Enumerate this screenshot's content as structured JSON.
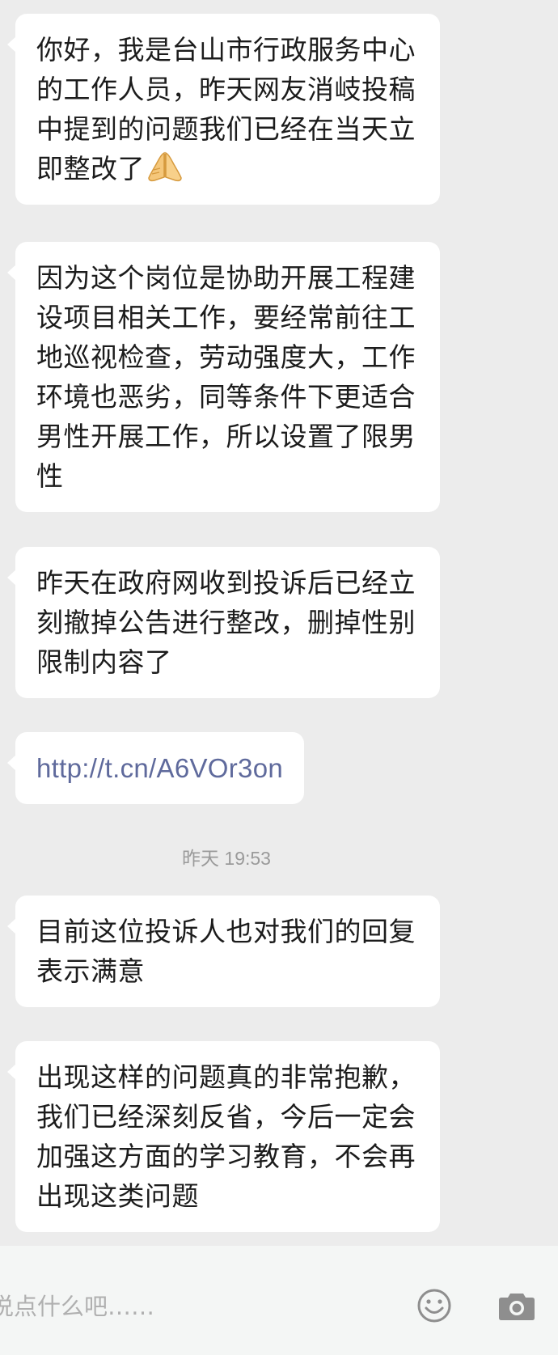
{
  "messages": [
    {
      "text": "你好，我是台山市行政服务中心的工作人员，昨天网友消岐投稿中提到的问题我们已经在当天立即整改了",
      "emoji": "folded-hands-emoji"
    },
    {
      "text": "因为这个岗位是协助开展工程建设项目相关工作，要经常前往工地巡视检查，劳动强度大，工作环境也恶劣，同等条件下更适合男性开展工作，所以设置了限男性"
    },
    {
      "text": "昨天在政府网收到投诉后已经立刻撤掉公告进行整改，删掉性别限制内容了"
    },
    {
      "text": "http://t.cn/A6VOr3on"
    },
    {
      "text": "目前这位投诉人也对我们的回复表示满意"
    },
    {
      "text": "出现这样的问题真的非常抱歉，我们已经深刻反省，今后一定会加强这方面的学习教育，不会再出现这类问题"
    }
  ],
  "timestamp": "昨天 19:53",
  "input": {
    "placeholder": "说点什么吧……",
    "value": ""
  },
  "icons": {
    "emoji_button": "smiley-face-icon",
    "camera_button": "camera-icon"
  },
  "colors": {
    "background": "#ececec",
    "bubble": "#ffffff",
    "link": "#5f6a9c",
    "timestamp": "#9a9a9a",
    "input_bar": "#f4f6f5",
    "icon": "#8e8e8e"
  }
}
